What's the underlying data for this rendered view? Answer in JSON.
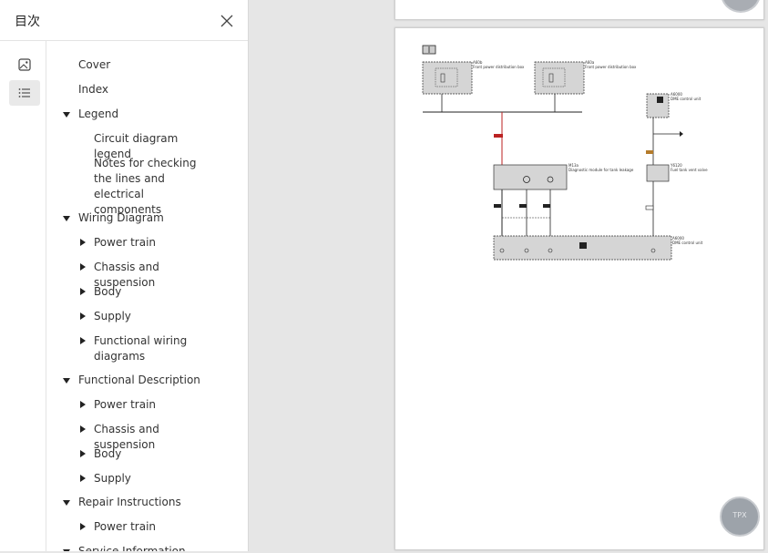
{
  "panel": {
    "title": "目次",
    "close_icon": "close-icon",
    "rail": [
      {
        "icon": "image-thumbnail-icon",
        "active": false
      },
      {
        "icon": "list-outline-icon",
        "active": true
      }
    ]
  },
  "toc": [
    {
      "label": "Cover",
      "level": 0,
      "toggle": "none"
    },
    {
      "label": "Index",
      "level": 0,
      "toggle": "none"
    },
    {
      "label": "Legend",
      "level": 0,
      "toggle": "expanded"
    },
    {
      "label": "Circuit diagram legend",
      "level": 1,
      "toggle": "none"
    },
    {
      "label": "Notes for checking the lines and electrical components",
      "level": 1,
      "toggle": "none"
    },
    {
      "label": "Wiring Diagram",
      "level": 0,
      "toggle": "expanded"
    },
    {
      "label": "Power train",
      "level": 1,
      "toggle": "collapsed"
    },
    {
      "label": "Chassis and suspension",
      "level": 1,
      "toggle": "collapsed"
    },
    {
      "label": "Body",
      "level": 1,
      "toggle": "collapsed"
    },
    {
      "label": "Supply",
      "level": 1,
      "toggle": "collapsed"
    },
    {
      "label": "Functional wiring diagrams",
      "level": 1,
      "toggle": "collapsed"
    },
    {
      "label": "Functional Description",
      "level": 0,
      "toggle": "expanded"
    },
    {
      "label": "Power train",
      "level": 1,
      "toggle": "collapsed"
    },
    {
      "label": "Chassis and suspension",
      "level": 1,
      "toggle": "collapsed"
    },
    {
      "label": "Body",
      "level": 1,
      "toggle": "collapsed"
    },
    {
      "label": "Supply",
      "level": 1,
      "toggle": "collapsed"
    },
    {
      "label": "Repair Instructions",
      "level": 0,
      "toggle": "expanded"
    },
    {
      "label": "Power train",
      "level": 1,
      "toggle": "collapsed"
    },
    {
      "label": "Service Information",
      "level": 0,
      "toggle": "expanded"
    }
  ],
  "diagram": {
    "labels": {
      "fdb1_id": "A60b",
      "fdb1_name": "Front power distribution box",
      "fdb2_id": "A60a",
      "fdb2_name": "Front power distribution box",
      "dme_id": "A6000",
      "dme_name": "DME control unit",
      "tank_id": "M13a",
      "tank_name": "Diagnostic module for tank leakage",
      "valve_id": "Y6120",
      "valve_name": "Fuel tank vent valve",
      "ctrl_id": "A6000",
      "ctrl_name": "DME control unit"
    }
  },
  "badge_bottom_text": "TPX"
}
